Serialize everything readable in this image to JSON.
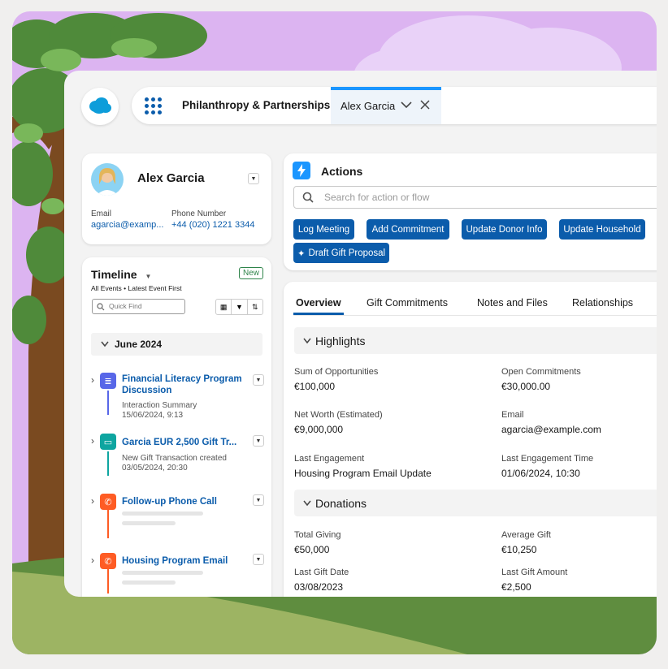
{
  "header": {
    "app_name": "Philanthropy & Partnerships",
    "active_tab": "Alex Garcia"
  },
  "profile": {
    "name": "Alex Garcia",
    "email_label": "Email",
    "email": "agarcia@examp...",
    "phone_label": "Phone Number",
    "phone": "+44 (020) 1221 3344"
  },
  "timeline": {
    "title": "Timeline",
    "new_label": "New",
    "filter_text": "All Events • Latest Event First",
    "quick_find_placeholder": "Quick Find",
    "month": "June 2024",
    "items": [
      {
        "title": "Financial Literacy Program Discussion",
        "sub1": "Interaction Summary",
        "sub2": "15/06/2024, 9:13"
      },
      {
        "title": "Garcia EUR 2,500 Gift Tr...",
        "sub1": "New Gift Transaction created",
        "sub2": "03/05/2024, 20:30"
      },
      {
        "title": "Follow-up Phone Call"
      },
      {
        "title": "Housing Program Email"
      }
    ]
  },
  "actions": {
    "title": "Actions",
    "search_placeholder": "Search for action or flow",
    "buttons": [
      "Log Meeting",
      "Add Commitment",
      "Update Donor Info",
      "Update Household",
      "Draft Gift Proposal"
    ]
  },
  "record_tabs": [
    "Overview",
    "Gift Commitments",
    "Notes and Files",
    "Relationships"
  ],
  "highlights": {
    "title": "Highlights",
    "fields": [
      {
        "label": "Sum of Opportunities",
        "value": "€100,000"
      },
      {
        "label": "Open Commitments",
        "value": "€30,000.00"
      },
      {
        "label": "Net Worth (Estimated)",
        "value": "€9,000,000"
      },
      {
        "label": "Email",
        "value": "agarcia@example.com"
      },
      {
        "label": "Last Engagement",
        "value": "Housing Program Email Update"
      },
      {
        "label": "Last Engagement Time",
        "value": "01/06/2024, 10:30"
      }
    ]
  },
  "donations": {
    "title": "Donations",
    "fields": [
      {
        "label": "Total Giving",
        "value": "€50,000"
      },
      {
        "label": "Average Gift",
        "value": "€10,250"
      },
      {
        "label": "Last Gift Date",
        "value": "03/08/2023"
      },
      {
        "label": "Last Gift Amount",
        "value": "€2,500"
      }
    ]
  },
  "colors": {
    "brand_blue": "#0b5cab",
    "tab_accent": "#1b96ff",
    "sky": "#dcb4f1",
    "grass": "#5f8d3f"
  },
  "icons": [
    "salesforce-cloud-icon",
    "app-launcher-icon",
    "chevron-down-icon",
    "close-icon",
    "lightning-icon",
    "search-icon",
    "calendar-icon",
    "filter-icon",
    "sort-icon",
    "document-icon",
    "money-icon",
    "phone-icon"
  ]
}
